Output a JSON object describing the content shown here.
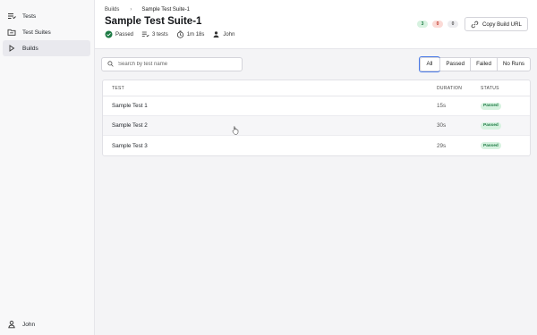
{
  "sidebar": {
    "items": [
      {
        "label": "Tests",
        "icon": "list-icon"
      },
      {
        "label": "Test Suites",
        "icon": "folder-icon"
      },
      {
        "label": "Builds",
        "icon": "play-icon",
        "active": true
      }
    ],
    "user": {
      "name": "John",
      "icon": "user-icon"
    }
  },
  "header": {
    "breadcrumb": {
      "root": "Builds",
      "separator": "›",
      "current": "Sample Test Suite-1"
    },
    "title": "Sample Test Suite-1",
    "meta": {
      "status": "Passed",
      "tests": "3 tests",
      "duration": "1m 18s",
      "user": "John"
    },
    "counts": {
      "passed": "3",
      "failed": "0",
      "no_runs": "0"
    },
    "copy_label": "Copy Build URL"
  },
  "search": {
    "placeholder": "Search by test name",
    "value": ""
  },
  "filters": [
    "All",
    "Passed",
    "Failed",
    "No Runs"
  ],
  "table": {
    "columns": [
      "TEST",
      "DURATION",
      "STATUS"
    ],
    "rows": [
      {
        "test": "Sample Test 1",
        "duration": "15s",
        "status": "Passed"
      },
      {
        "test": "Sample Test 2",
        "duration": "30s",
        "status": "Passed"
      },
      {
        "test": "Sample Test 3",
        "duration": "29s",
        "status": "Passed"
      }
    ]
  },
  "colors": {
    "accent": "#4a7ae8",
    "passed_bg": "#d7f2e0",
    "passed_fg": "#1d7a44",
    "failed_bg": "#fbdad6",
    "failed_fg": "#c0392b"
  }
}
